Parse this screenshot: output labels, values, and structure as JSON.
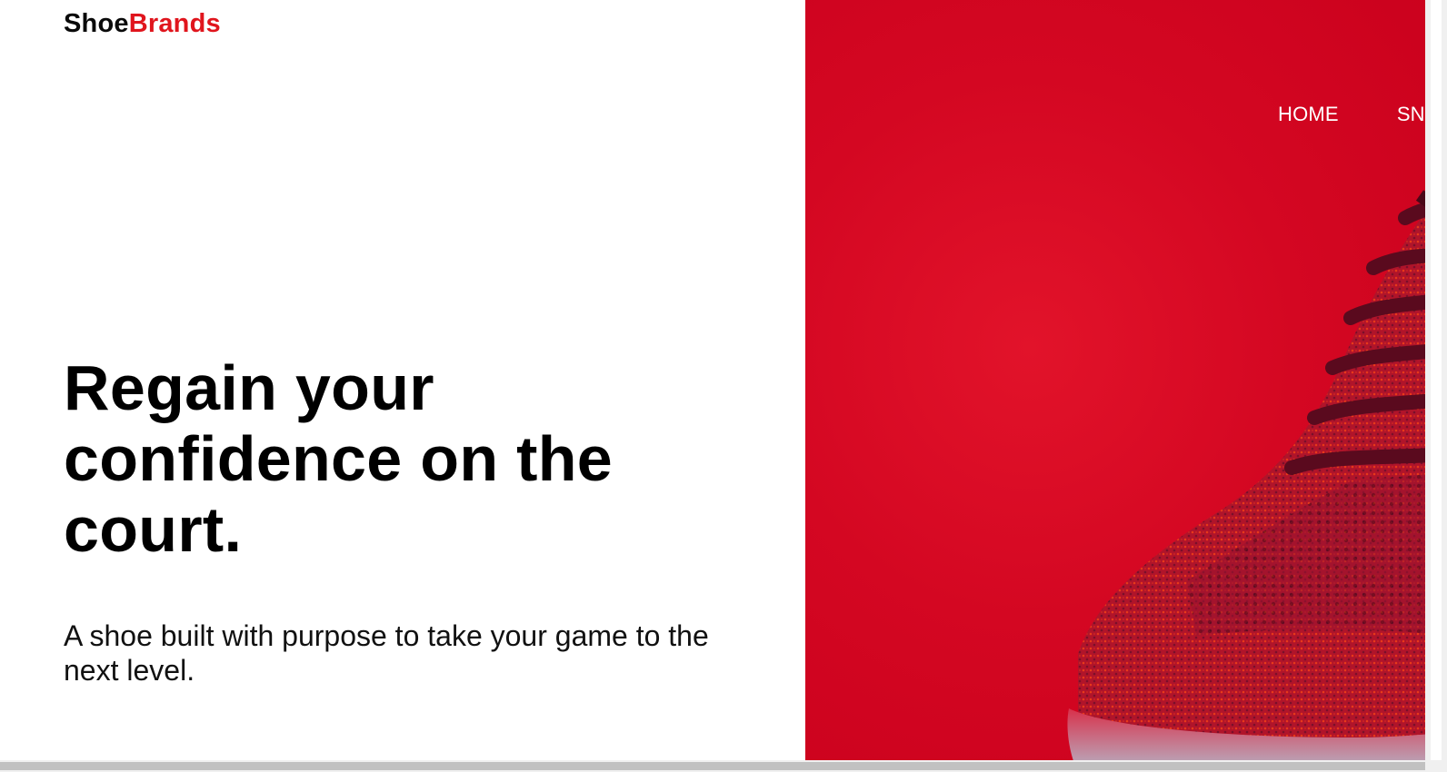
{
  "brand": {
    "logo_part1": "Shoe",
    "logo_part2": "Brands",
    "accent_color": "#e0151d"
  },
  "hero": {
    "headline": "Regain your confidence on the court.",
    "subtext": "A shoe built with purpose to take your game to the next level.",
    "background_color": "#d40722"
  },
  "nav": {
    "items": [
      {
        "label": "HOME"
      },
      {
        "label": "SNEAKERS"
      }
    ]
  },
  "image": {
    "icon": "red-knit-sneaker"
  }
}
